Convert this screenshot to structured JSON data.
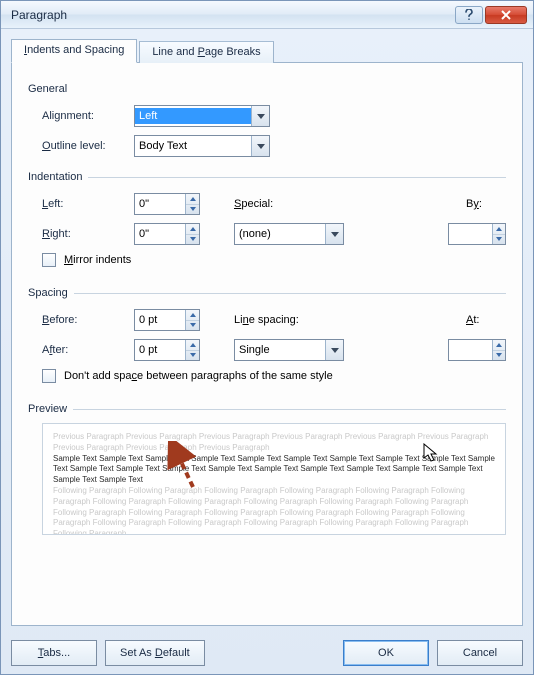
{
  "title": "Paragraph",
  "tabs": {
    "indents": "Indents and Spacing",
    "breaks": "Line and Page Breaks"
  },
  "general": {
    "header": "General",
    "alignment_label": "Alignment:",
    "alignment_value": "Left",
    "outline_label": "Outline level:",
    "outline_value": "Body Text"
  },
  "indentation": {
    "header": "Indentation",
    "left_label": "Left:",
    "left_value": "0\"",
    "right_label": "Right:",
    "right_value": "0\"",
    "special_label": "Special:",
    "special_value": "(none)",
    "by_label": "By:",
    "by_value": "",
    "mirror_label": "Mirror indents"
  },
  "spacing": {
    "header": "Spacing",
    "before_label": "Before:",
    "before_value": "0 pt",
    "after_label": "After:",
    "after_value": "0 pt",
    "line_label": "Line spacing:",
    "line_value": "Single",
    "at_label": "At:",
    "at_value": "",
    "nospace_label": "Don't add space between paragraphs of the same style"
  },
  "preview": {
    "header": "Preview",
    "prev_para": "Previous Paragraph Previous Paragraph Previous Paragraph Previous Paragraph Previous Paragraph Previous Paragraph Previous Paragraph Previous Paragraph Previous Paragraph",
    "sample": "Sample Text Sample Text Sample Text Sample Text Sample Text Sample Text Sample Text Sample Text Sample Text Sample Text Sample Text Sample Text Sample Text Sample Text Sample Text Sample Text Sample Text Sample Text Sample Text Sample Text Sample Text",
    "next_para": "Following Paragraph Following Paragraph Following Paragraph Following Paragraph Following Paragraph Following Paragraph Following Paragraph Following Paragraph Following Paragraph Following Paragraph Following Paragraph Following Paragraph Following Paragraph Following Paragraph Following Paragraph Following Paragraph Following Paragraph Following Paragraph Following Paragraph Following Paragraph Following Paragraph Following Paragraph Following Paragraph"
  },
  "buttons": {
    "tabs": "Tabs...",
    "default": "Set As Default",
    "ok": "OK",
    "cancel": "Cancel"
  }
}
